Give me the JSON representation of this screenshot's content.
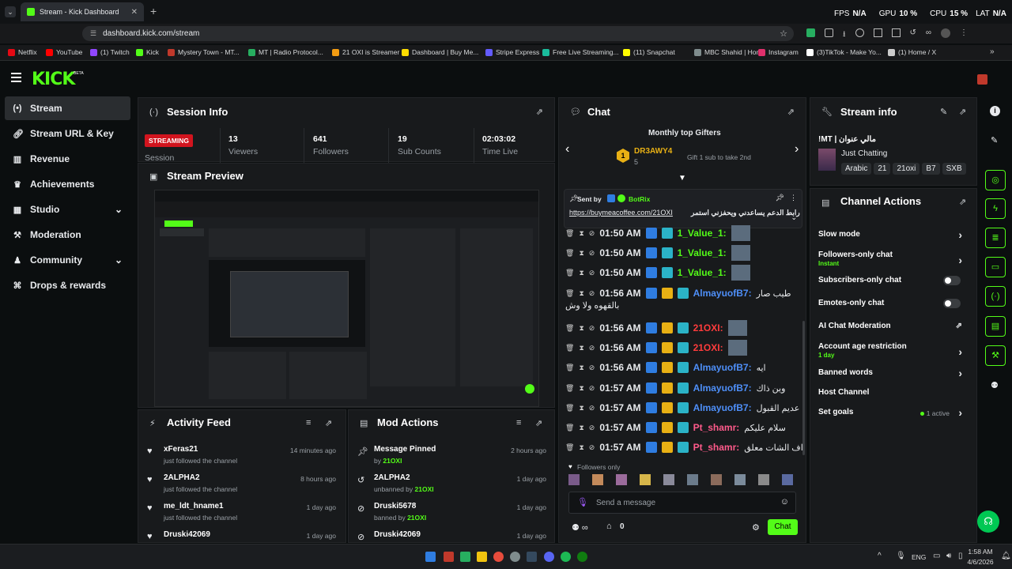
{
  "browser": {
    "tab_title": "Stream - Kick Dashboard",
    "url": "dashboard.kick.com/stream",
    "overlay": {
      "fps_label": "FPS",
      "fps_value": "N/A",
      "gpu_label": "GPU",
      "gpu_value": "10 %",
      "cpu_label": "CPU",
      "cpu_value": "15 %",
      "lat_label": "LAT",
      "lat_value": "N/A"
    },
    "bookmarks": [
      {
        "label": "Netflix",
        "color": "#e50914"
      },
      {
        "label": "YouTube",
        "color": "#ff0000"
      },
      {
        "label": "(1) Twitch",
        "color": "#9146ff"
      },
      {
        "label": "Kick",
        "color": "#53fc18"
      },
      {
        "label": "Mystery Town - MT...",
        "color": "#c0392b"
      },
      {
        "label": "MT | Radio Protocol...",
        "color": "#27ae60"
      },
      {
        "label": "21 OXI is Streamer",
        "color": "#f39c12"
      },
      {
        "label": "Dashboard | Buy Me...",
        "color": "#ffdd00"
      },
      {
        "label": "Stripe Express",
        "color": "#635bff"
      },
      {
        "label": "Free Live Streaming...",
        "color": "#1abc9c"
      },
      {
        "label": "(11) Snapchat",
        "color": "#fffc00"
      },
      {
        "label": "MBC Shahid | Home",
        "color": "#7f8c8d"
      },
      {
        "label": "Instagram",
        "color": "#e1306c"
      },
      {
        "label": "(3)TikTok - Make Yo...",
        "color": "#ffffff"
      },
      {
        "label": "(1) Home / X",
        "color": "#cccccc"
      }
    ]
  },
  "header": {
    "logo": "KICK",
    "beta": "BETA"
  },
  "sidebar": {
    "items": [
      {
        "label": "Stream",
        "icon": "broadcast-icon"
      },
      {
        "label": "Stream URL & Key",
        "icon": "link-icon"
      },
      {
        "label": "Revenue",
        "icon": "chart-icon"
      },
      {
        "label": "Achievements",
        "icon": "trophy-icon"
      },
      {
        "label": "Studio",
        "icon": "studio-icon"
      },
      {
        "label": "Moderation",
        "icon": "hammer-icon"
      },
      {
        "label": "Community",
        "icon": "community-icon"
      },
      {
        "label": "Drops & rewards",
        "icon": "gift-icon"
      }
    ]
  },
  "session": {
    "title": "Session Info",
    "status": "STREAMING",
    "session_label": "Session",
    "stats": [
      {
        "value": "13",
        "label": "Viewers"
      },
      {
        "value": "641",
        "label": "Followers"
      },
      {
        "value": "19",
        "label": "Sub Counts"
      },
      {
        "value": "02:03:02",
        "label": "Time Live"
      }
    ]
  },
  "preview": {
    "title": "Stream Preview"
  },
  "activity": {
    "title": "Activity Feed",
    "items": [
      {
        "name": "xFeras21",
        "text": "just followed the channel",
        "time": "14 minutes ago"
      },
      {
        "name": "2ALPHA2",
        "text": "just followed the channel",
        "time": "8 hours ago"
      },
      {
        "name": "me_ldt_hname1",
        "text": "just followed the channel",
        "time": "1 day ago"
      },
      {
        "name": "Druski42069",
        "text": "",
        "time": "1 day ago"
      }
    ]
  },
  "mod_actions": {
    "title": "Mod Actions",
    "items": [
      {
        "name": "Message Pinned",
        "prefix": "by",
        "by": "21OXI",
        "time": "2 hours ago"
      },
      {
        "name": "2ALPHA2",
        "prefix": "unbanned by",
        "by": "21OXI",
        "time": "1 day ago"
      },
      {
        "name": "Druski5678",
        "prefix": "banned by",
        "by": "21OXI",
        "time": "1 day ago"
      },
      {
        "name": "Druski42069",
        "prefix": "",
        "by": "",
        "time": "1 day ago"
      }
    ]
  },
  "chat": {
    "title": "Chat",
    "gifters_title": "Monthly top Gifters",
    "top_gifter": "DR3AWY4",
    "top_gifter_count": "5",
    "rank": "1",
    "gift_hint": "Gift 1 sub to take 2nd",
    "pinned": {
      "sent_by": "Sent by",
      "user": "BotRix",
      "link": "https://buymeacoffee.com/21OXI",
      "message": "رابط الدعم يساعدني ويحفزني استمر"
    },
    "messages": [
      {
        "time": "01:50 AM",
        "user": "1_Value_1:",
        "color": "#53fc18",
        "text": ""
      },
      {
        "time": "01:50 AM",
        "user": "1_Value_1:",
        "color": "#53fc18",
        "text": ""
      },
      {
        "time": "01:50 AM",
        "user": "1_Value_1:",
        "color": "#53fc18",
        "text": ""
      },
      {
        "time": "01:56 AM",
        "user": "AlmayuofB7:",
        "color": "#4e8ff8",
        "text": "طيب صار",
        "cont": "بالقهوه ولا وش"
      },
      {
        "time": "01:56 AM",
        "user": "21OXI:",
        "color": "#ff3c3c",
        "text": ""
      },
      {
        "time": "01:56 AM",
        "user": "21OXI:",
        "color": "#ff3c3c",
        "text": ""
      },
      {
        "time": "01:56 AM",
        "user": "AlmayuofB7:",
        "color": "#4e8ff8",
        "text": "ايه"
      },
      {
        "time": "01:57 AM",
        "user": "AlmayuofB7:",
        "color": "#4e8ff8",
        "text": "وين ذاك"
      },
      {
        "time": "01:57 AM",
        "user": "AlmayuofB7:",
        "color": "#4e8ff8",
        "text": "عديم القبول"
      },
      {
        "time": "01:57 AM",
        "user": "Pt_shamr:",
        "color": "#ff5a8a",
        "text": "سلام عليكم"
      },
      {
        "time": "01:57 AM",
        "user": "Pt_shamr:",
        "color": "#ff5a8a",
        "text": "اف الشات معلق"
      }
    ],
    "followers_only": "Followers only",
    "input_placeholder": "Send a message",
    "points": "0",
    "send_label": "Chat"
  },
  "stream_info": {
    "title": "Stream info",
    "stream_title": "!MT | مالي عنوان",
    "category": "Just Chatting",
    "tags": [
      "Arabic",
      "21",
      "21oxi",
      "B7",
      "SXB"
    ]
  },
  "channel_actions": {
    "title": "Channel Actions",
    "items": [
      {
        "label": "Slow mode",
        "sub": "",
        "control": "chevron"
      },
      {
        "label": "Followers-only chat",
        "sub": "Instant",
        "control": "chevron"
      },
      {
        "label": "Subscribers-only chat",
        "sub": "",
        "control": "toggle"
      },
      {
        "label": "Emotes-only chat",
        "sub": "",
        "control": "toggle"
      },
      {
        "label": "AI Chat Moderation",
        "sub": "",
        "control": "external"
      },
      {
        "label": "Account age restriction",
        "sub": "1 day",
        "control": "chevron"
      },
      {
        "label": "Banned words",
        "sub": "",
        "control": "chevron"
      },
      {
        "label": "Host Channel",
        "sub": "",
        "control": "none"
      },
      {
        "label": "Set goals",
        "sub": "",
        "control": "chevron",
        "status": "1 active"
      }
    ]
  },
  "taskbar": {
    "lang": "ENG",
    "time": "1:58 AM",
    "date": "4/6/2026"
  }
}
